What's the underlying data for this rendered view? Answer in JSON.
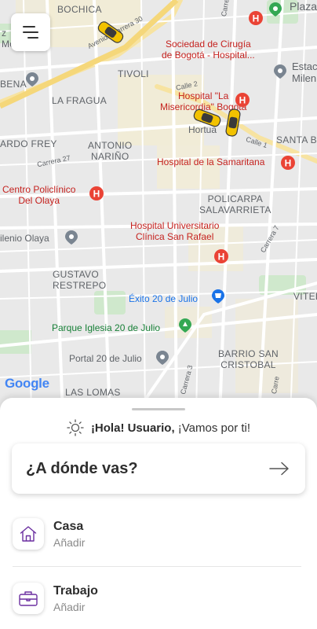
{
  "map": {
    "provider_logo": "Google",
    "labels": {
      "bochica": "BOCHICA",
      "plaza": "Plaza",
      "avenida_carrera_30": "Avenida Carrera 30",
      "tivoli": "TIVOLI",
      "sociedad_cirugia": "Sociedad de Cirugía\nde Bogotá - Hospital...",
      "estacion": "Estac\nMilen",
      "la_fragua": "LA FRAGUA",
      "calle_2": "Calle 2",
      "hospital_misericordia": "Hospital \"La\nMisericordia\" Bogotá",
      "hortua": "Hortua",
      "santa_barbara": "SANTA BA",
      "ardo_frey": "ARDO FREY",
      "antonio_narino": "ANTONIO\nNARIÑO",
      "calle_1": "Calle 1",
      "carrera_27": "Carrera 27",
      "hospital_samaritana": "Hospital de la Samaritana",
      "centro_policlinico": "Centro Policlínico\nDel Olaya",
      "policarpa": "POLICARPA\nSALAVARRIETA",
      "milenio_olaya": "ilenio Olaya",
      "hospital_universitario": "Hospital Universitario\nClínica San Rafael",
      "carrera_7": "Carrera 7",
      "gustavo_restrepo": "GUSTAVO\nRESTREPO",
      "exito": "Éxito 20 de Julio",
      "vitel": "VITEL",
      "parque_iglesia": "Parque Iglesia 20 de Julio",
      "portal_20_julio": "Portal 20 de Julio",
      "barrio_san_cristobal": "BARRIO SAN\nCRISTOBAL",
      "las_lomas": "LAS LOMAS",
      "carrera_3": "Carrera 3",
      "carrera_x": "Carre",
      "carrera_top": "Carrera",
      "bena": "BENA",
      "z_mo": "z\nMo"
    }
  },
  "sheet": {
    "greeting_name": "¡Hola! Usuario,",
    "greeting_rest": " ¡Vamos por ti!",
    "search_placeholder": "¿A dónde vas?",
    "places": [
      {
        "title": "Casa",
        "subtitle": "Añadir",
        "icon": "home-icon"
      },
      {
        "title": "Trabajo",
        "subtitle": "Añadir",
        "icon": "briefcase-icon"
      }
    ]
  },
  "colors": {
    "accent_purple": "#6b2fa0",
    "hospital_red": "#c5221f",
    "taxi_yellow": "#f2c200",
    "park_green": "#c8e6c9",
    "map_bg": "#e9e9e9"
  }
}
